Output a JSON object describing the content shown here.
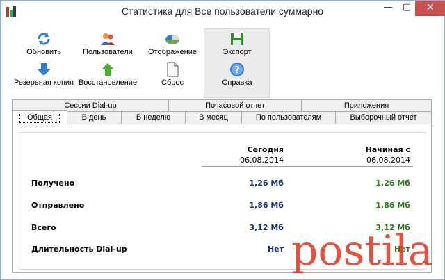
{
  "window": {
    "title": "Статистика для Все пользователи суммарно",
    "minimize_glyph": "—",
    "maximize_glyph": "▢",
    "close_glyph": "✕"
  },
  "toolbar": {
    "refresh_label": "Обновить",
    "users_label": "Пользователи",
    "display_label": "Отображение",
    "export_label": "Экспорт",
    "backup_label": "Резервная копия",
    "restore_label": "Восстановление",
    "reset_label": "Сброс",
    "help_label": "Справка"
  },
  "tabs": {
    "row1": [
      "Сессии Dial-up",
      "Почасовой отчет",
      "Приложения"
    ],
    "row2": [
      "Общая",
      "В день",
      "В неделю",
      "В месяц",
      "По пользователям",
      "Выборочный отчет"
    ],
    "active": "Общая"
  },
  "stats": {
    "col_today_header": "Сегодня",
    "col_today_date": "06.08.2014",
    "col_since_header": "Начиная с",
    "col_since_date": "06.08.2014",
    "rows": [
      {
        "label": "Получено",
        "today": "1,26 Мб",
        "since": "1,26 Мб"
      },
      {
        "label": "Отправлено",
        "today": "1,86 Мб",
        "since": "1,86 Мб"
      },
      {
        "label": "Всего",
        "today": "3,12 Мб",
        "since": "3,12 Мб"
      },
      {
        "label": "Длительность Dial-up",
        "today": "Нет",
        "since": "Нет"
      }
    ]
  },
  "watermark": {
    "text": "postila.ru"
  },
  "colors": {
    "today_value": "#1c2f7a",
    "since_value": "#2b7a1c",
    "close_button": "#c75050",
    "watermark": "#e0311d"
  }
}
